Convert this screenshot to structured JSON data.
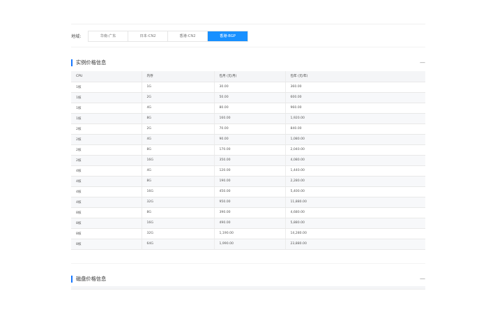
{
  "region": {
    "label": "地域:",
    "tabs": [
      "华南-广东",
      "日本-CN2",
      "香港-CN2",
      "香港-BGP"
    ],
    "active": 3
  },
  "instance_section": {
    "title": "实例价格信息",
    "collapse": "—"
  },
  "disk_section": {
    "title": "磁盘价格信息",
    "collapse": "—"
  },
  "table": {
    "headers": [
      "CPU",
      "内存",
      "包月 (元/月)",
      "包年 (元/年)"
    ],
    "rows": [
      [
        "1核",
        "1G",
        "30.00",
        "360.00"
      ],
      [
        "1核",
        "2G",
        "50.00",
        "600.00"
      ],
      [
        "1核",
        "4G",
        "80.00",
        "960.00"
      ],
      [
        "1核",
        "8G",
        "160.00",
        "1,920.00"
      ],
      [
        "2核",
        "2G",
        "70.00",
        "840.00"
      ],
      [
        "2核",
        "4G",
        "90.00",
        "1,080.00"
      ],
      [
        "2核",
        "8G",
        "170.00",
        "2,040.00"
      ],
      [
        "2核",
        "16G",
        "350.00",
        "4,080.00"
      ],
      [
        "4核",
        "4G",
        "120.00",
        "1,440.00"
      ],
      [
        "4核",
        "8G",
        "190.00",
        "2,280.00"
      ],
      [
        "4核",
        "16G",
        "450.00",
        "5,400.00"
      ],
      [
        "4核",
        "32G",
        "950.00",
        "11,880.00"
      ],
      [
        "8核",
        "8G",
        "390.00",
        "4,680.00"
      ],
      [
        "8核",
        "16G",
        "490.00",
        "5,880.00"
      ],
      [
        "8核",
        "32G",
        "1,190.00",
        "14,280.00"
      ],
      [
        "8核",
        "64G",
        "1,990.00",
        "23,880.00"
      ]
    ]
  },
  "colors": {
    "accent": "#1890ff",
    "section_bar": "#1677ff",
    "header_bg": "#f4f5f7"
  }
}
